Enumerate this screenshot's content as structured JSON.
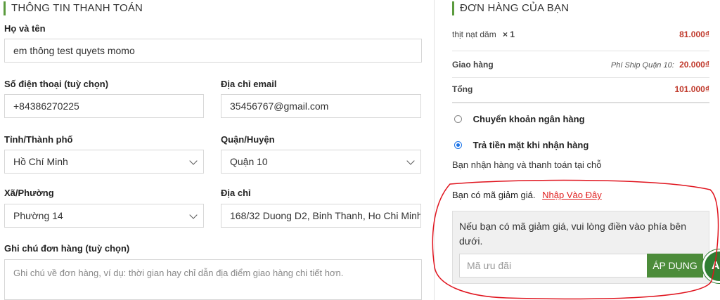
{
  "billing": {
    "title": "THÔNG TIN THANH TOÁN",
    "fullname_label": "Họ và tên",
    "fullname_value": "em thông test quyets momo",
    "phone_label": "Số điện thoại (tuỳ chọn)",
    "phone_value": "+84386270225",
    "email_label": "Địa chỉ email",
    "email_value": "35456767@gmail.com",
    "city_label": "Tỉnh/Thành phố",
    "city_value": "Hồ Chí Minh",
    "district_label": "Quận/Huyện",
    "district_value": "Quận 10",
    "ward_label": "Xã/Phường",
    "ward_value": "Phường 14",
    "address_label": "Địa chỉ",
    "address_value": "168/32 Duong D2, Binh Thanh, Ho Chi Minh",
    "note_label": "Ghi chú đơn hàng (tuỳ chọn)",
    "note_placeholder": "Ghi chú về đơn hàng, ví dụ: thời gian hay chỉ dẫn địa điểm giao hàng chi tiết hơn."
  },
  "order": {
    "title": "ĐƠN HÀNG CỦA BẠN",
    "item_name": "thịt nạt dăm",
    "item_qty": "× 1",
    "item_price": "81.000₫",
    "shipping_label": "Giao hàng",
    "shipping_method": "Phí Ship Quận 10:",
    "shipping_price": "20.000₫",
    "total_label": "Tổng",
    "total_value": "101.000₫"
  },
  "payment": {
    "option_bank": "Chuyển khoản ngân hàng",
    "option_cod": "Trả tiền mặt khi nhận hàng",
    "cod_desc": "Bạn nhận hàng và thanh toán tại chỗ",
    "selected": "cod"
  },
  "coupon": {
    "prompt": "Bạn có mã giảm giá.",
    "link": "Nhập Vào Đây",
    "box_text": "Nếu bạn có mã giảm giá, vui lòng điền vào phía bên dưới.",
    "input_placeholder": "Mã ưu đãi",
    "apply_label": "ÁP DỤNG",
    "badge": "A"
  },
  "colors": {
    "accent_green": "#4c8c3a",
    "price_red": "#c0392b",
    "link_red": "#e02020",
    "radio_blue": "#1a73e8",
    "annotation_red": "#e0141e"
  }
}
